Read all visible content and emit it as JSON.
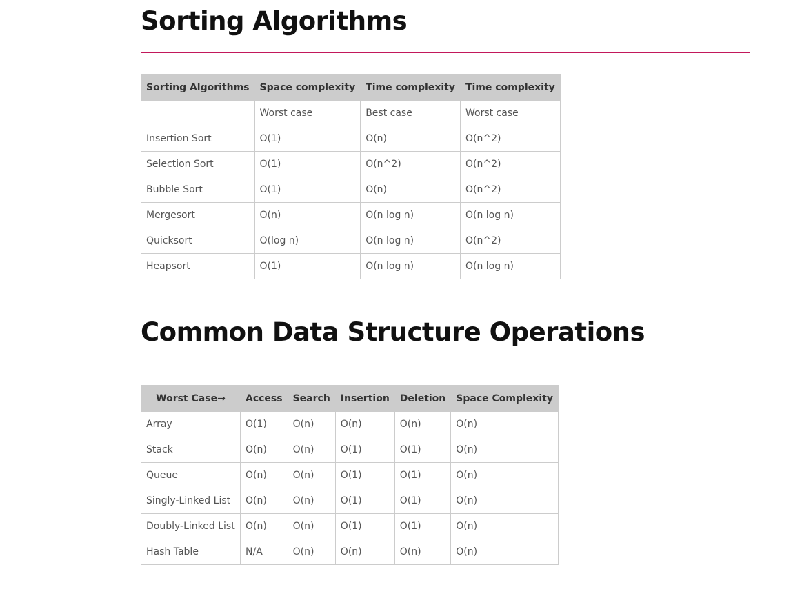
{
  "sorting": {
    "heading": "Sorting Algorithms",
    "header": [
      "Sorting Algorithms",
      "Space complexity",
      "Time complexity",
      "Time complexity"
    ],
    "subheader": [
      "",
      "Worst case",
      "Best case",
      "Worst case"
    ],
    "rows": [
      [
        "Insertion Sort",
        "O(1)",
        "O(n)",
        "O(n^2)"
      ],
      [
        "Selection Sort",
        "O(1)",
        "O(n^2)",
        "O(n^2)"
      ],
      [
        "Bubble Sort",
        "O(1)",
        "O(n)",
        "O(n^2)"
      ],
      [
        "Mergesort",
        "O(n)",
        "O(n log n)",
        "O(n log n)"
      ],
      [
        "Quicksort",
        "O(log n)",
        "O(n log n)",
        "O(n^2)"
      ],
      [
        "Heapsort",
        "O(1)",
        "O(n log n)",
        "O(n log n)"
      ]
    ]
  },
  "operations": {
    "heading": "Common Data Structure Operations",
    "header": [
      "Worst Case→",
      "Access",
      "Search",
      "Insertion",
      "Deletion",
      "Space Complexity"
    ],
    "rows": [
      [
        "Array",
        "O(1)",
        "O(n)",
        "O(n)",
        "O(n)",
        "O(n)"
      ],
      [
        "Stack",
        "O(n)",
        "O(n)",
        "O(1)",
        "O(1)",
        "O(n)"
      ],
      [
        "Queue",
        "O(n)",
        "O(n)",
        "O(1)",
        "O(1)",
        "O(n)"
      ],
      [
        "Singly-Linked List",
        "O(n)",
        "O(n)",
        "O(1)",
        "O(1)",
        "O(n)"
      ],
      [
        "Doubly-Linked List",
        "O(n)",
        "O(n)",
        "O(1)",
        "O(1)",
        "O(n)"
      ],
      [
        "Hash Table",
        "N/A",
        "O(n)",
        "O(n)",
        "O(n)",
        "O(n)"
      ]
    ]
  },
  "colors": {
    "rule": "#c2185b",
    "header_bg": "#cccccc",
    "border": "#cccccc",
    "heading_text": "#111111",
    "cell_text": "#555555"
  }
}
